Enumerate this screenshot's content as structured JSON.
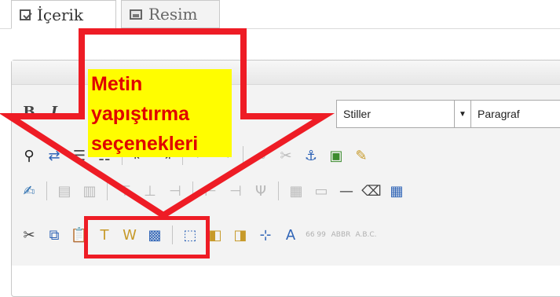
{
  "tabs": [
    {
      "label": "İçerik",
      "icon": "edit-icon",
      "active": true
    },
    {
      "label": "Resim",
      "icon": "image-icon",
      "active": false
    }
  ],
  "toolbar": {
    "row1": {
      "bold": "B",
      "italic": "I"
    },
    "styles_select": "Stiller",
    "format_select": "Paragraf"
  },
  "annotation": {
    "text": "Metin\nyapıştırma\nseçenekleri",
    "text_color": "#e00000",
    "highlight_color": "#fffd00",
    "arrow_color": "#ee1c25"
  }
}
